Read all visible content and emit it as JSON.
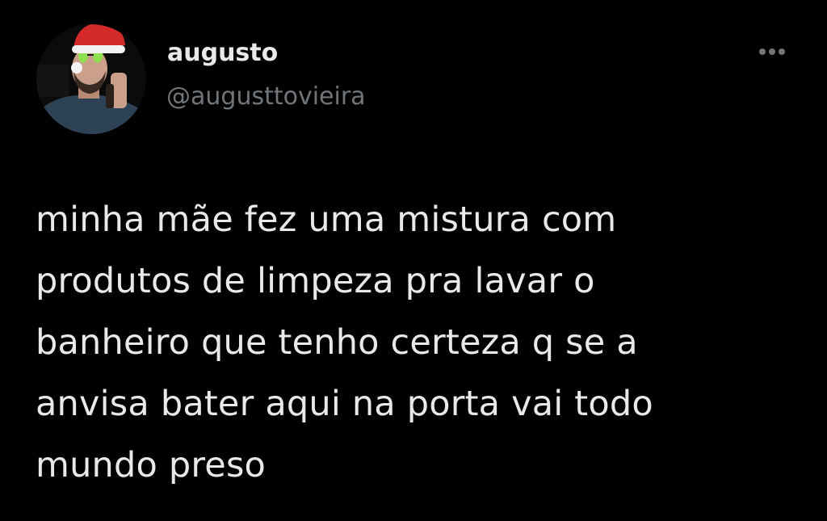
{
  "tweet": {
    "author": {
      "display_name": "augusto",
      "handle": "@augusttovieira",
      "avatar_icon": "profile-photo-santa-hat-icon"
    },
    "more_icon": "more-options-ellipsis-icon",
    "text": "minha mãe fez uma mistura com\nprodutos de limpeza pra lavar o\nbanheiro que tenho certeza q se a\nanvisa bater aqui na porta vai todo\nmundo preso"
  },
  "colors": {
    "background": "#000000",
    "primary_text": "#e7e9ea",
    "secondary_text": "#71767b"
  }
}
